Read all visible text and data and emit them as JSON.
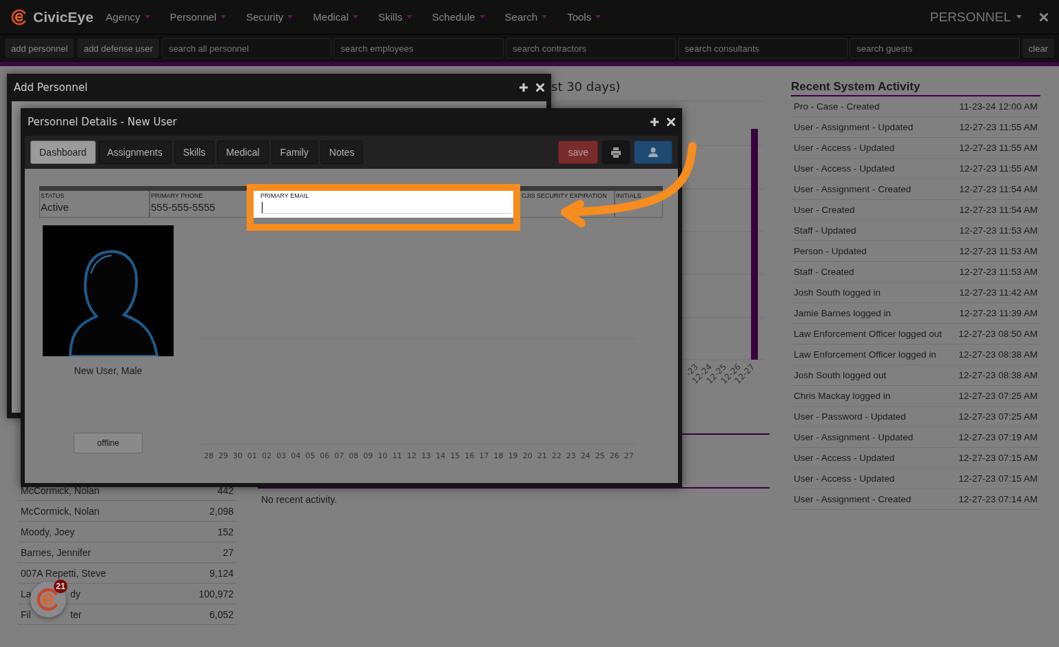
{
  "nav": {
    "brand": "CivicEye",
    "menus": [
      "Agency",
      "Personnel",
      "Security",
      "Medical",
      "Skills",
      "Schedule",
      "Search",
      "Tools"
    ],
    "module": "PERSONNEL"
  },
  "toolbar": {
    "buttons": [
      "add personnel",
      "add defense user"
    ],
    "searches": [
      {
        "placeholder": "search all personnel"
      },
      {
        "placeholder": "search employees"
      },
      {
        "placeholder": "search contractors"
      },
      {
        "placeholder": "search consultants"
      },
      {
        "placeholder": "search guests"
      }
    ],
    "clear": "clear"
  },
  "background": {
    "chart_title": "st 30 days)",
    "chart_x_labels": [
      "-23",
      "12-24",
      "12-25",
      "12-26",
      "12-27"
    ],
    "empty_message": "No recent activity.",
    "rows": [
      {
        "name": "McCormick, Nolan",
        "value": "442"
      },
      {
        "name": "McCormick, Nolan",
        "value": "2,098"
      },
      {
        "name": "Moody, Joey",
        "value": "152"
      },
      {
        "name": "Barnes, Jennifer",
        "value": "27"
      },
      {
        "name": "007A Repetti, Steve",
        "value": "9,124"
      },
      {
        "name": "La",
        "name_end": "dy",
        "value": "100,972"
      },
      {
        "name": "Fil",
        "name_end": "ter",
        "value": "6,052"
      }
    ]
  },
  "activity": {
    "title": "Recent System Activity",
    "rows": [
      {
        "event": "Pro - Case - Created",
        "time": "11-23-24 12:00 AM"
      },
      {
        "event": "User - Assignment - Updated",
        "time": "12-27-23 11:55 AM"
      },
      {
        "event": "User - Access - Updated",
        "time": "12-27-23 11:55 AM"
      },
      {
        "event": "User - Access - Updated",
        "time": "12-27-23 11:55 AM"
      },
      {
        "event": "User - Assignment - Created",
        "time": "12-27-23 11:54 AM"
      },
      {
        "event": "User - Created",
        "time": "12-27-23 11:54 AM"
      },
      {
        "event": "Staff - Updated",
        "time": "12-27-23 11:53 AM"
      },
      {
        "event": "Person - Updated",
        "time": "12-27-23 11:53 AM"
      },
      {
        "event": "Staff - Created",
        "time": "12-27-23 11:53 AM"
      },
      {
        "event": "Josh South logged in",
        "time": "12-27-23 11:42 AM"
      },
      {
        "event": "Jamie Barnes logged in",
        "time": "12-27-23 11:39 AM"
      },
      {
        "event": "Law Enforcement Officer logged out",
        "time": "12-27-23 08:50 AM"
      },
      {
        "event": "Law Enforcement Officer logged in",
        "time": "12-27-23 08:38 AM"
      },
      {
        "event": "Josh South logged out",
        "time": "12-27-23 08:38 AM"
      },
      {
        "event": "Chris Mackay logged in",
        "time": "12-27-23 07:25 AM"
      },
      {
        "event": "User - Password - Updated",
        "time": "12-27-23 07:25 AM"
      },
      {
        "event": "User - Assignment - Updated",
        "time": "12-27-23 07:19 AM"
      },
      {
        "event": "User - Access - Updated",
        "time": "12-27-23 07:15 AM"
      },
      {
        "event": "User - Access - Updated",
        "time": "12-27-23 07:15 AM"
      },
      {
        "event": "User - Assignment - Created",
        "time": "12-27-23 07:14 AM"
      }
    ]
  },
  "back_window": {
    "title": "Add Personnel"
  },
  "details": {
    "title": "Personnel Details - New User",
    "tabs": [
      {
        "label": "Dashboard",
        "selected": true
      },
      {
        "label": "Assignments",
        "selected": false
      },
      {
        "label": "Skills",
        "selected": false
      },
      {
        "label": "Medical",
        "selected": false
      },
      {
        "label": "Family",
        "selected": false
      },
      {
        "label": "Notes",
        "selected": false
      }
    ],
    "save": "save",
    "fields": [
      {
        "label": "STATUS",
        "value": "Active"
      },
      {
        "label": "PRIMARY PHONE",
        "value": "555-555-5555"
      },
      {
        "label": "PRIMARY EMAIL",
        "kind": "input",
        "focused": true
      },
      {
        "label": "CJIS SECURITY EXPIRATION"
      },
      {
        "label": "INITIALS"
      }
    ],
    "profile": {
      "caption": "New User, Male",
      "status": "offline"
    },
    "chart_x_labels": [
      "28",
      "29",
      "30",
      "01",
      "02",
      "03",
      "04",
      "05",
      "06",
      "07",
      "08",
      "09",
      "10",
      "11",
      "12",
      "13",
      "14",
      "15",
      "16",
      "17",
      "18",
      "19",
      "20",
      "21",
      "22",
      "23",
      "24",
      "25",
      "26",
      "27"
    ]
  },
  "notification_count": "21"
}
